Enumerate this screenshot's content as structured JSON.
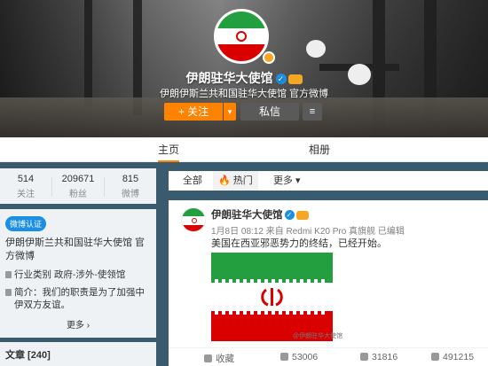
{
  "profile": {
    "name": "伊朗驻华大使馆",
    "description": "伊朗伊斯兰共和国驻华大使馆 官方微博",
    "follow_label": "+ 关注",
    "message_label": "私信",
    "menu_icon": "≡",
    "caret_icon": "▾",
    "verified_icon": "✓"
  },
  "tabs": [
    {
      "label": "主页",
      "active": true
    },
    {
      "label": "相册",
      "active": false
    }
  ],
  "stats": [
    {
      "value": "514",
      "label": "关注"
    },
    {
      "value": "209671",
      "label": "粉丝"
    },
    {
      "value": "815",
      "label": "微博"
    }
  ],
  "info": {
    "badge": "微博认证",
    "org": "伊朗伊斯兰共和国驻华大使馆 官方微博",
    "industry": "行业类别 政府-涉外-使领馆",
    "intro": "简介：我们的职责是为了加强中伊双方友谊。",
    "more": "更多 ›",
    "articles": "文章 [240]"
  },
  "feed_tabs": [
    {
      "label": "全部"
    },
    {
      "label": "热门",
      "active": true
    },
    {
      "label": "更多 ▾"
    }
  ],
  "post": {
    "author": "伊朗驻华大使馆",
    "meta": "1月8日 08:12 来自 Redmi K20 Pro 真旗舰   已编辑",
    "text": "美国在西亚邪恶势力的终结，已经开始。",
    "watermark": "@伊朗驻华大使馆"
  },
  "actions": {
    "collect": "收藏",
    "repost": "53006",
    "comment": "31816",
    "like": "491215"
  },
  "colors": {
    "accent": "#ff8200",
    "verified": "#1a8fe3",
    "flag_green": "#239f40",
    "flag_red": "#da0000"
  }
}
